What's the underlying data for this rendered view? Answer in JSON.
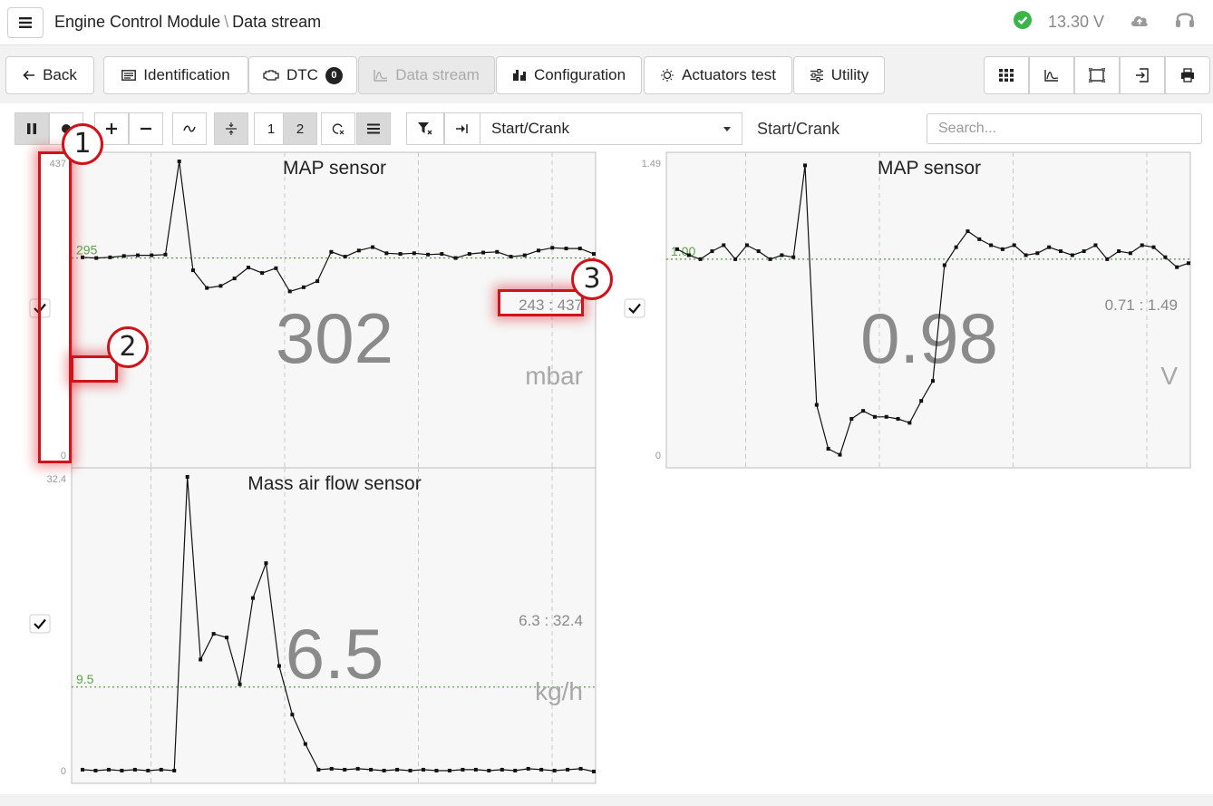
{
  "header": {
    "module": "Engine Control Module",
    "separator": "\\",
    "page": "Data stream",
    "voltage": "13.30 V",
    "icons": [
      "menu-icon",
      "check-circle-icon",
      "cloud-upload-icon",
      "headset-icon"
    ],
    "ok_color": "#3bb54a"
  },
  "nav": {
    "back": "Back",
    "identification": "Identification",
    "dtc": "DTC",
    "dtc_count": "0",
    "data_stream": "Data stream",
    "configuration": "Configuration",
    "actuators": "Actuators test",
    "utility": "Utility",
    "right_icons": [
      "grid-icon",
      "chart-icon",
      "fit-icon",
      "export-icon",
      "print-icon"
    ]
  },
  "toolbar": {
    "page_1": "1",
    "page_2": "2",
    "preset_selected": "Start/Crank",
    "preset_label": "Start/Crank",
    "search_placeholder": "Search..."
  },
  "annotations": [
    "1",
    "2",
    "3"
  ],
  "accent_color": "#d0121b",
  "chart_data": [
    {
      "type": "line",
      "title": "MAP sensor",
      "value": "302",
      "unit": "mbar",
      "ymin_label": "0",
      "ymax_label": "437",
      "ylim": [
        0,
        437
      ],
      "ref_value": "295",
      "ref": 295,
      "range_label": "243 : 437",
      "checked": true,
      "values": [
        296,
        295,
        296,
        298,
        299,
        299,
        300,
        437,
        277,
        251,
        254,
        265,
        281,
        273,
        280,
        246,
        252,
        261,
        304,
        297,
        306,
        311,
        302,
        301,
        302,
        300,
        301,
        295,
        301,
        303,
        304,
        297,
        299,
        306,
        310,
        309,
        309,
        301
      ]
    },
    {
      "type": "line",
      "title": "MAP sensor",
      "value": "0.98",
      "unit": "V",
      "ymin_label": "0",
      "ymax_label": "1.49",
      "ylim": [
        0,
        1.49
      ],
      "ref_value": "1.00",
      "ref": 1.0,
      "range_label": "0.71 : 1.49",
      "checked": true,
      "values": [
        1.05,
        1.02,
        1.0,
        1.04,
        1.07,
        1.0,
        1.07,
        1.04,
        1.0,
        1.02,
        1.01,
        1.47,
        0.27,
        0.05,
        0.02,
        0.2,
        0.24,
        0.21,
        0.21,
        0.2,
        0.18,
        0.29,
        0.39,
        0.97,
        1.06,
        1.14,
        1.1,
        1.07,
        1.05,
        1.07,
        1.02,
        1.03,
        1.06,
        1.04,
        1.02,
        1.04,
        1.07,
        1.0,
        1.04,
        1.03,
        1.07,
        1.06,
        1.01,
        0.96,
        0.98
      ]
    },
    {
      "type": "line",
      "title": "Mass air flow sensor",
      "value": "6.5",
      "unit": "kg/h",
      "ymin_label": "0",
      "ymax_label": "32.4",
      "ylim": [
        0,
        32.4
      ],
      "ref_value": "9.5",
      "ref": 9.5,
      "range_label": "6.3 : 32.4",
      "checked": true,
      "values": [
        0.5,
        0.4,
        0.5,
        0.4,
        0.5,
        0.4,
        0.5,
        0.4,
        32.4,
        12.5,
        15.3,
        14.9,
        9.8,
        19.2,
        23.0,
        11.8,
        6.5,
        3.3,
        0.5,
        0.6,
        0.5,
        0.6,
        0.5,
        0.4,
        0.5,
        0.4,
        0.5,
        0.4,
        0.4,
        0.5,
        0.5,
        0.4,
        0.5,
        0.4,
        0.6,
        0.5,
        0.4,
        0.5,
        0.6,
        0.3
      ]
    }
  ]
}
